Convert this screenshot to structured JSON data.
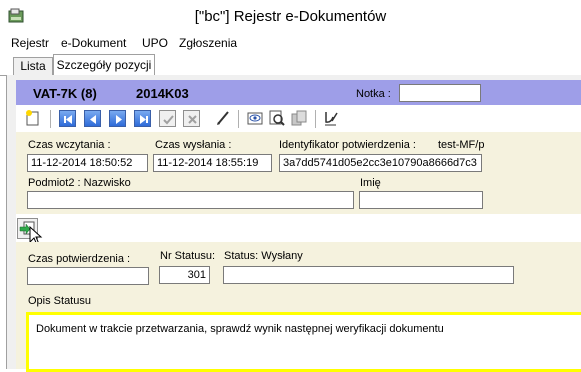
{
  "window": {
    "title": "[\"bc\"] Rejestr e-Dokumentów"
  },
  "menu": {
    "items": [
      "Rejestr",
      "e-Dokument",
      "UPO",
      "Zgłoszenia"
    ]
  },
  "tabs": [
    {
      "label": "Lista",
      "active": false
    },
    {
      "label": "Szczegóły pozycji",
      "active": true
    }
  ],
  "header": {
    "doc_type": "VAT-7K (8)",
    "period": "2014K03",
    "notka_label": "Notka :",
    "notka_value": ""
  },
  "toolbar": {
    "icons": [
      "new-document-icon",
      "first-record-icon",
      "previous-record-icon",
      "next-record-icon",
      "last-record-icon",
      "confirm-icon",
      "cancel-icon",
      "edit-pen-icon",
      "view-icon",
      "preview-search-icon",
      "copy-icon",
      "sign-icon"
    ]
  },
  "form": {
    "czas_wczytania_label": "Czas wczytania :",
    "czas_wczytania": "11-12-2014 18:50:52",
    "czas_wyslania_label": "Czas wysłania :",
    "czas_wyslania": "11-12-2014 18:55:19",
    "identyfikator_label": "Identyfikator potwierdzenia :",
    "identyfikator_suffix": "test-MF/p",
    "identyfikator": "3a7dd5741d05e2cc3e10790a8666d7c3",
    "podmiot_label": "Podmiot2 : Nazwisko",
    "podmiot": "",
    "imie_label": "Imię",
    "imie": "",
    "czas_potwierdzenia_label": "Czas potwierdzenia :",
    "czas_potwierdzenia": "",
    "nr_statusu_label": "Nr Statusu:",
    "nr_statusu": "301",
    "status_label": "Status: Wysłany",
    "status": "",
    "opis_statusu_label": "Opis Statusu",
    "opis_statusu": "Dokument w trakcie przetwarzania, sprawdź wynik następnej weryfikacji dokumentu"
  },
  "colors": {
    "header_band": "#9e9ee8",
    "form_bg": "#f5f2de",
    "highlight_border": "#ffff00"
  }
}
